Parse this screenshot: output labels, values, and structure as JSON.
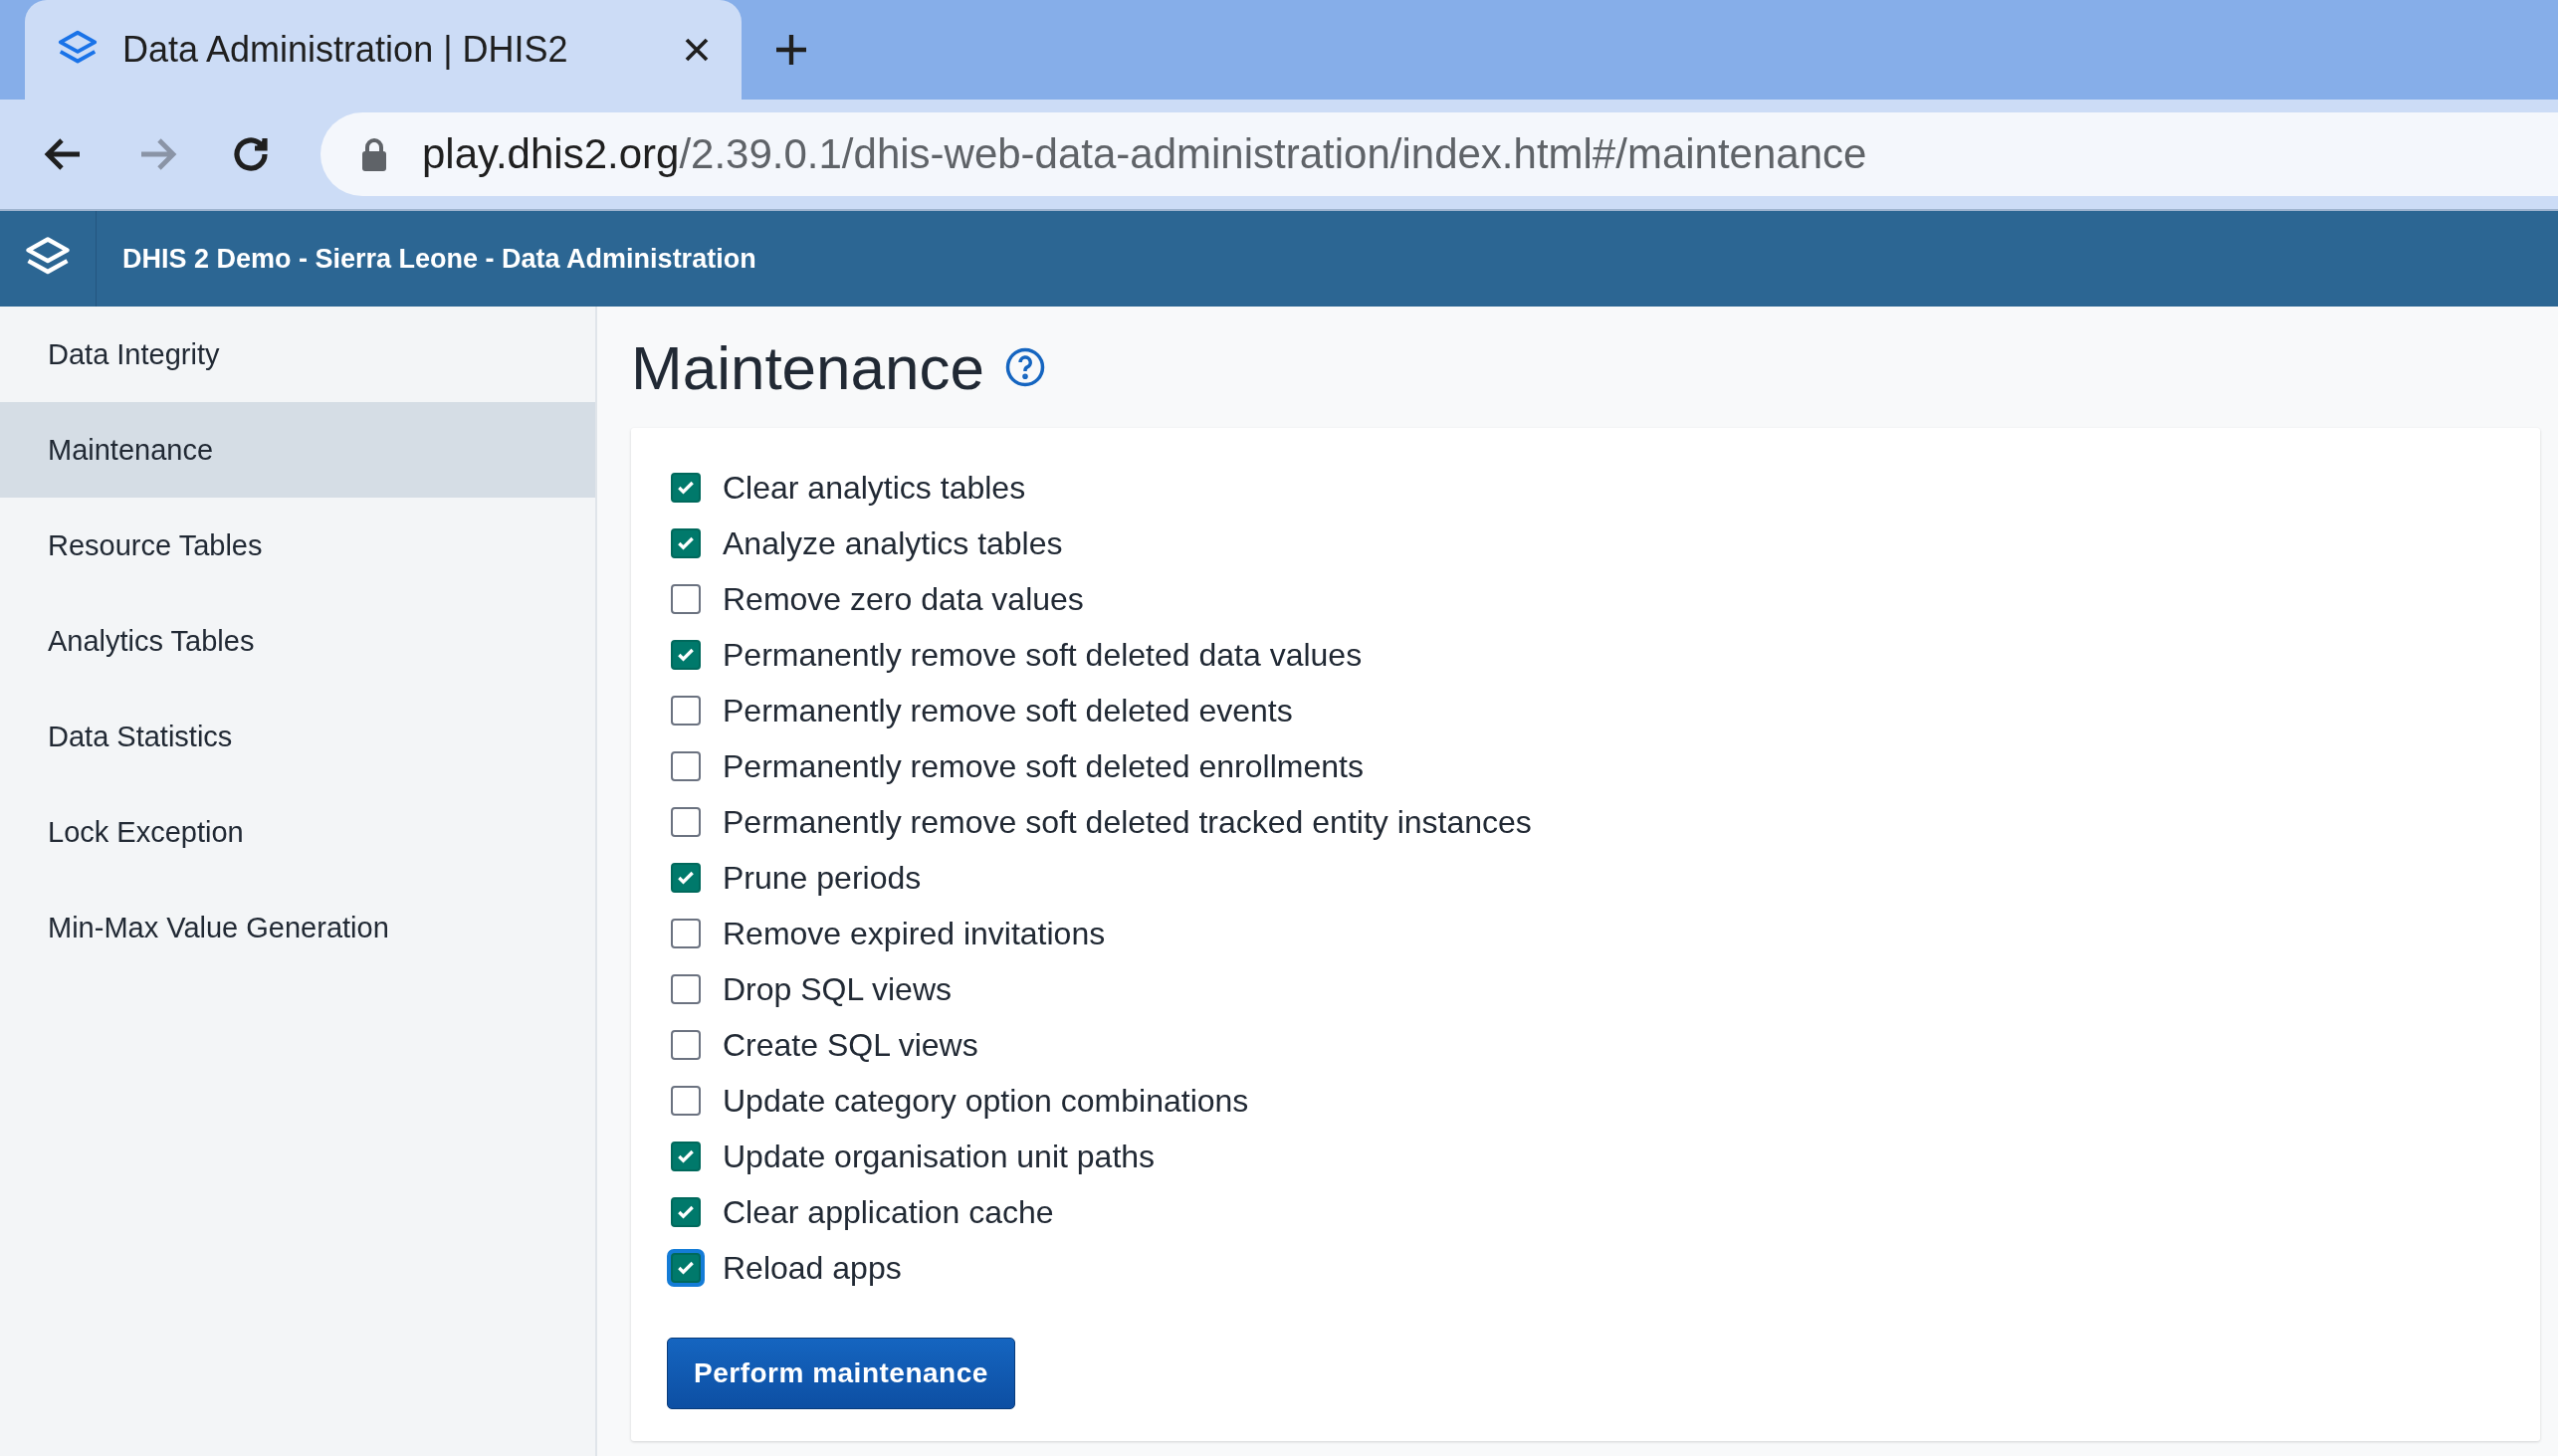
{
  "browser": {
    "tab_title": "Data Administration | DHIS2",
    "url_host": "play.dhis2.org",
    "url_path": "/2.39.0.1/dhis-web-data-administration/index.html#/maintenance"
  },
  "header": {
    "title": "DHIS 2 Demo - Sierra Leone - Data Administration"
  },
  "sidebar": {
    "items": [
      {
        "label": "Data Integrity",
        "selected": false
      },
      {
        "label": "Maintenance",
        "selected": true
      },
      {
        "label": "Resource Tables",
        "selected": false
      },
      {
        "label": "Analytics Tables",
        "selected": false
      },
      {
        "label": "Data Statistics",
        "selected": false
      },
      {
        "label": "Lock Exception",
        "selected": false
      },
      {
        "label": "Min-Max Value Generation",
        "selected": false
      }
    ]
  },
  "page": {
    "title": "Maintenance"
  },
  "options": [
    {
      "label": "Clear analytics tables",
      "checked": true,
      "focused": false
    },
    {
      "label": "Analyze analytics tables",
      "checked": true,
      "focused": false
    },
    {
      "label": "Remove zero data values",
      "checked": false,
      "focused": false
    },
    {
      "label": "Permanently remove soft deleted data values",
      "checked": true,
      "focused": false
    },
    {
      "label": "Permanently remove soft deleted events",
      "checked": false,
      "focused": false
    },
    {
      "label": "Permanently remove soft deleted enrollments",
      "checked": false,
      "focused": false
    },
    {
      "label": "Permanently remove soft deleted tracked entity instances",
      "checked": false,
      "focused": false
    },
    {
      "label": "Prune periods",
      "checked": true,
      "focused": false
    },
    {
      "label": "Remove expired invitations",
      "checked": false,
      "focused": false
    },
    {
      "label": "Drop SQL views",
      "checked": false,
      "focused": false
    },
    {
      "label": "Create SQL views",
      "checked": false,
      "focused": false
    },
    {
      "label": "Update category option combinations",
      "checked": false,
      "focused": false
    },
    {
      "label": "Update organisation unit paths",
      "checked": true,
      "focused": false
    },
    {
      "label": "Clear application cache",
      "checked": true,
      "focused": false
    },
    {
      "label": "Reload apps",
      "checked": true,
      "focused": true
    }
  ],
  "action_button": {
    "label": "Perform maintenance"
  }
}
